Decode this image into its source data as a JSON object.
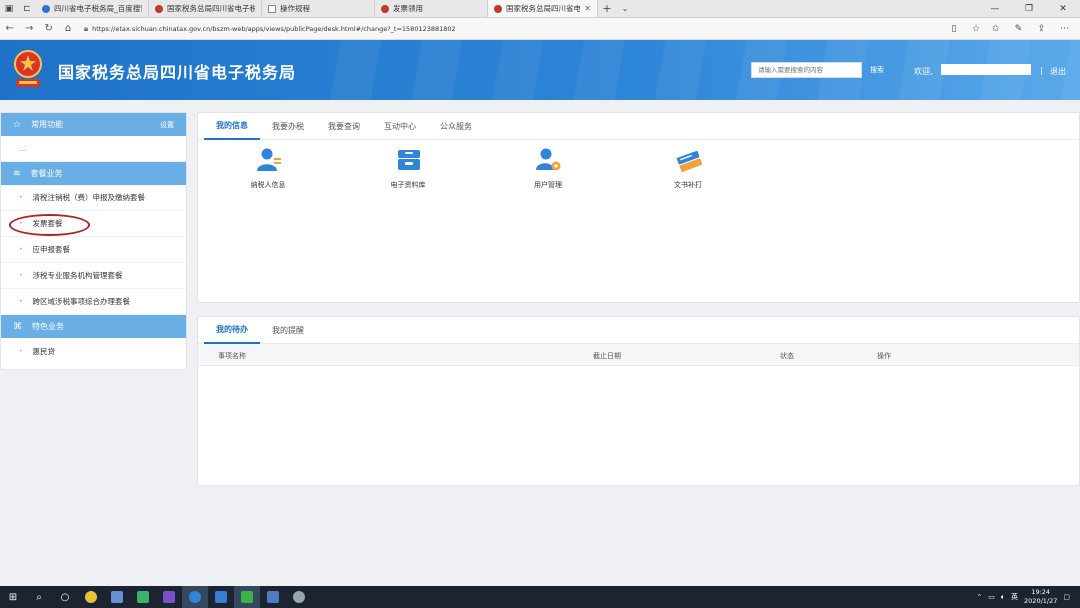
{
  "browser": {
    "tabs": [
      {
        "title": "四川省电子税务局_百度搜索",
        "color": "#2f6fd6"
      },
      {
        "title": "国家税务总局四川省电子税",
        "color": "#c0392b"
      },
      {
        "title": "操作规程",
        "color": "#888888"
      },
      {
        "title": "发票领用",
        "color": "#c0392b"
      },
      {
        "title": "国家税务总局四川省电子",
        "color": "#c0392b",
        "active": true
      }
    ],
    "url": "https://etax.sichuan.chinatax.gov.cn/bszm-web/apps/views/publicPage/desk.html#/change?_t=1580123881802"
  },
  "header": {
    "title": "国家税务总局四川省电子税务局",
    "search_placeholder": "请输入需要搜索的内容",
    "search_label": "搜索",
    "welcome": "欢迎,",
    "separator": "|",
    "logout": "退出"
  },
  "sidebar": {
    "common": {
      "title": "常用功能",
      "settings": "设置",
      "placeholder": "..."
    },
    "packages": {
      "title": "套餐业务",
      "items": [
        "清税注销税（费）申报及缴纳套餐",
        "发票套餐",
        "应申报套餐",
        "涉税专业服务机构管理套餐",
        "跨区域涉税事项综合办理套餐"
      ]
    },
    "special": {
      "title": "特色业务",
      "items": [
        "惠民贷"
      ]
    }
  },
  "info_panel": {
    "tabs": [
      "我的信息",
      "我要办税",
      "我要查询",
      "互动中心",
      "公众服务"
    ],
    "tiles": [
      "纳税人信息",
      "电子资料库",
      "用户管理",
      "文书补打"
    ]
  },
  "todo_panel": {
    "tabs": [
      "我的待办",
      "我的提醒"
    ],
    "columns": [
      "事项名称",
      "截止日期",
      "状态",
      "操作"
    ]
  },
  "taskbar": {
    "ime": "英",
    "time": "19:24",
    "date": "2020/1/27"
  },
  "colors": {
    "brand_blue": "#1e73c8",
    "section_blue": "#6aaee6",
    "annotation_red": "#b22222"
  }
}
